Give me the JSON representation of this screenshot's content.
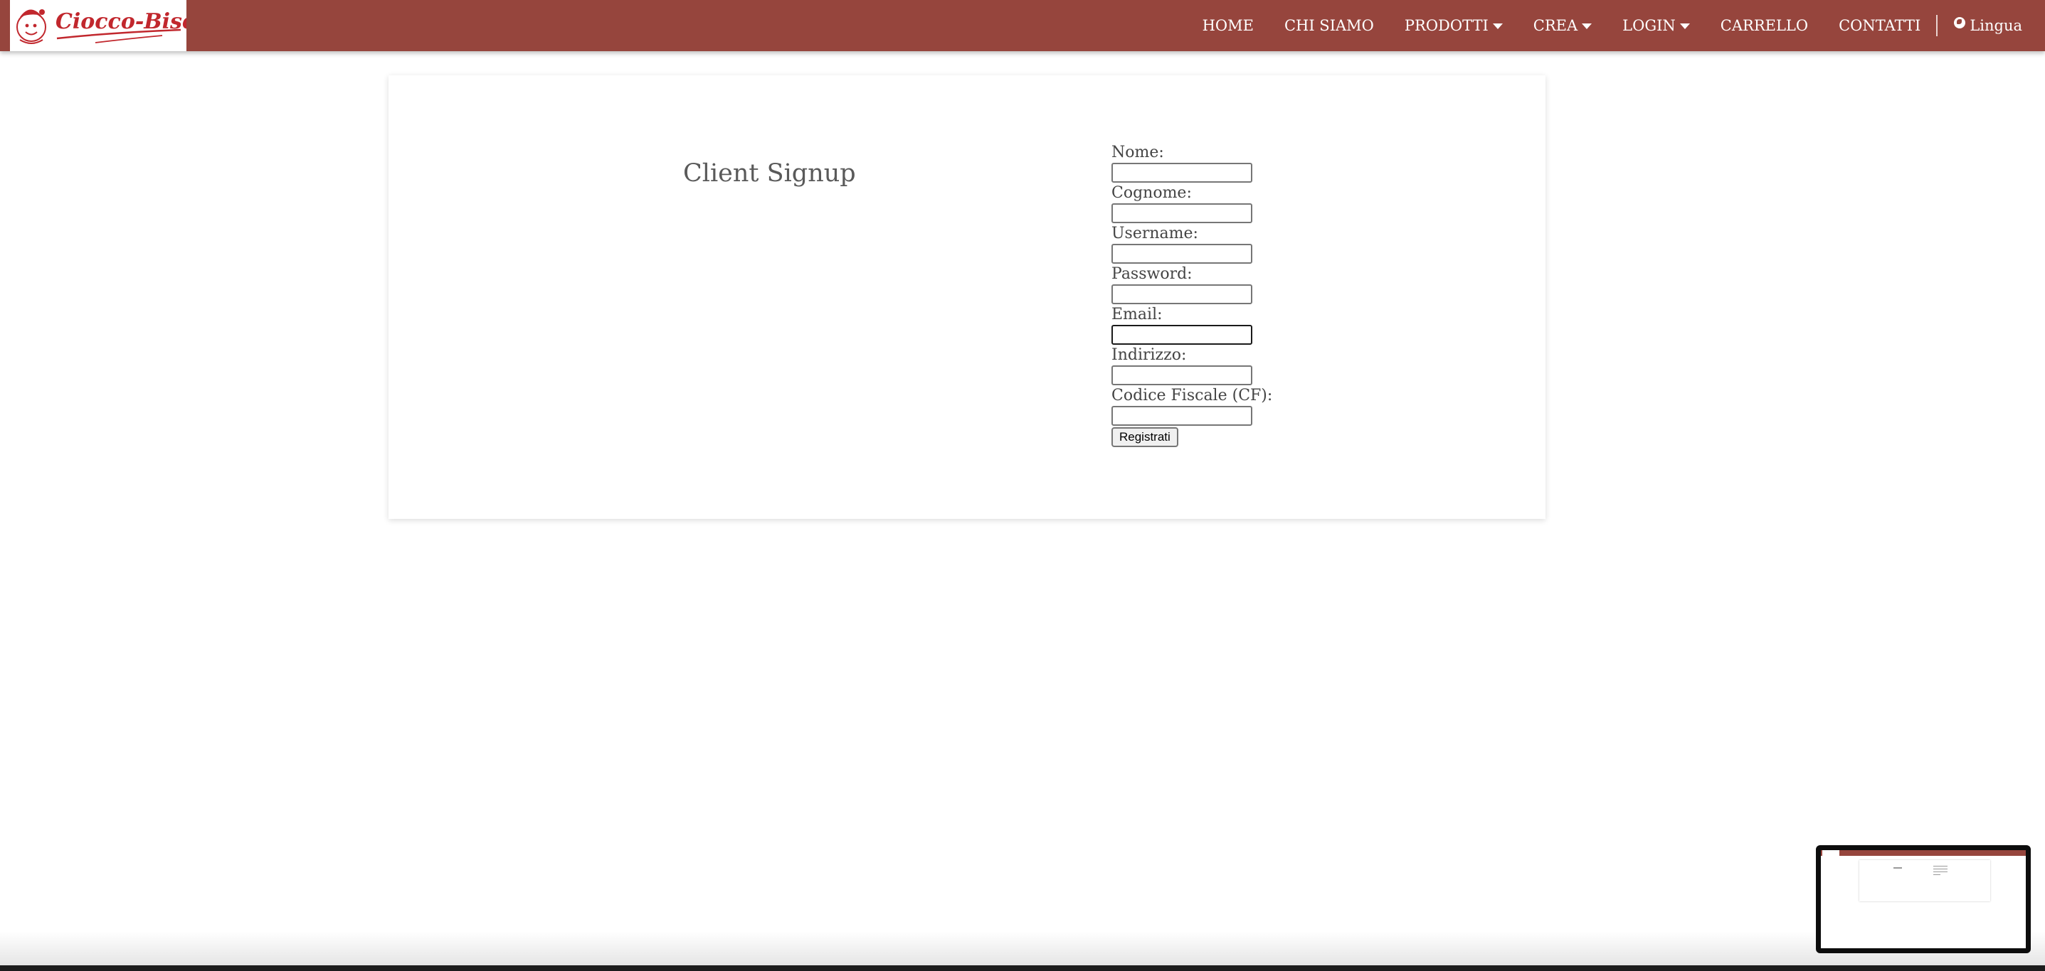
{
  "brand": {
    "name": "Ciocco-Bisco",
    "colors": {
      "navbar": "#96453d",
      "logo_text": "#c1272d"
    }
  },
  "nav": {
    "items": [
      {
        "label": "HOME",
        "dropdown": false
      },
      {
        "label": "CHI SIAMO",
        "dropdown": false
      },
      {
        "label": "PRODOTTI",
        "dropdown": true
      },
      {
        "label": "CREA",
        "dropdown": true
      },
      {
        "label": "LOGIN",
        "dropdown": true
      },
      {
        "label": "CARRELLO",
        "dropdown": false
      },
      {
        "label": "CONTATTI",
        "dropdown": false
      }
    ],
    "language": {
      "label": "Lingua",
      "icon": "globe-icon"
    }
  },
  "page": {
    "title": "Client Signup"
  },
  "form": {
    "fields": [
      {
        "label": "Nome:",
        "value": ""
      },
      {
        "label": "Cognome:",
        "value": ""
      },
      {
        "label": "Username:",
        "value": ""
      },
      {
        "label": "Password:",
        "value": ""
      },
      {
        "label": "Email:",
        "value": "",
        "focused": true
      },
      {
        "label": "Indirizzo:",
        "value": ""
      },
      {
        "label": "Codice Fiscale (CF):",
        "value": ""
      }
    ],
    "submit_label": "Registrati"
  }
}
